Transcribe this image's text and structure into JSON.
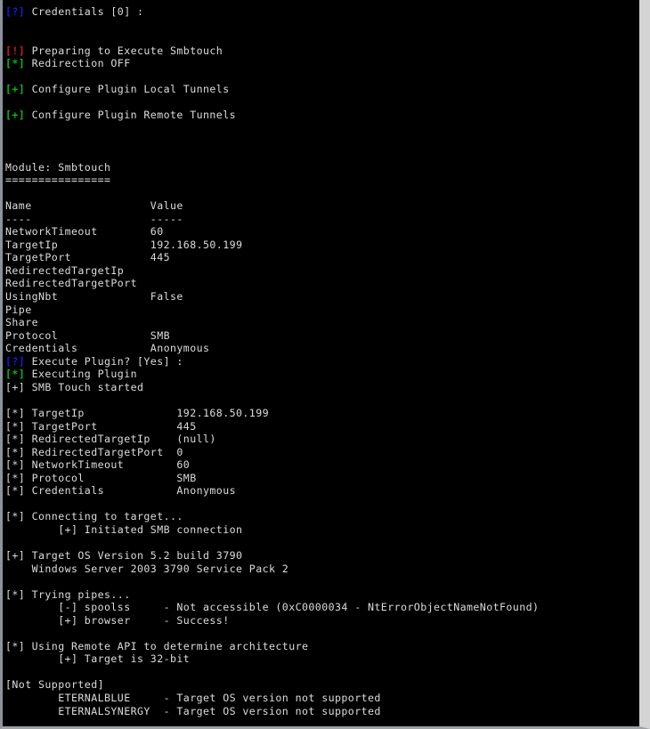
{
  "terminal": {
    "title": "fuzzbunch-smbtouch-console",
    "colors": {
      "background": "#000000",
      "foreground": "#d8d8d8",
      "prompt_blue": "#1a1ad6",
      "warn_red": "#c21f1f",
      "ok_green": "#10b410",
      "window_border": "#d4d4d4"
    },
    "lines": [
      {
        "tag": "[?]",
        "tag_color": "blue",
        "text": " Credentials [0] :"
      },
      {
        "tag": "",
        "tag_color": "none",
        "text": ""
      },
      {
        "tag": "",
        "tag_color": "none",
        "text": ""
      },
      {
        "tag": "[!]",
        "tag_color": "red",
        "text": " Preparing to Execute Smbtouch"
      },
      {
        "tag": "[*]",
        "tag_color": "green",
        "text": " Redirection OFF"
      },
      {
        "tag": "",
        "tag_color": "none",
        "text": ""
      },
      {
        "tag": "[+]",
        "tag_color": "green",
        "text": " Configure Plugin Local Tunnels"
      },
      {
        "tag": "",
        "tag_color": "none",
        "text": ""
      },
      {
        "tag": "[+]",
        "tag_color": "green",
        "text": " Configure Plugin Remote Tunnels"
      },
      {
        "tag": "",
        "tag_color": "none",
        "text": ""
      },
      {
        "tag": "",
        "tag_color": "none",
        "text": ""
      },
      {
        "tag": "",
        "tag_color": "none",
        "text": ""
      },
      {
        "tag": "",
        "tag_color": "none",
        "text": "Module: Smbtouch"
      },
      {
        "tag": "",
        "tag_color": "none",
        "text": "================"
      },
      {
        "tag": "",
        "tag_color": "none",
        "text": ""
      },
      {
        "tag": "",
        "tag_color": "none",
        "text": "Name                  Value"
      },
      {
        "tag": "",
        "tag_color": "none",
        "text": "----                  -----"
      },
      {
        "tag": "",
        "tag_color": "none",
        "text": "NetworkTimeout        60"
      },
      {
        "tag": "",
        "tag_color": "none",
        "text": "TargetIp              192.168.50.199"
      },
      {
        "tag": "",
        "tag_color": "none",
        "text": "TargetPort            445"
      },
      {
        "tag": "",
        "tag_color": "none",
        "text": "RedirectedTargetIp"
      },
      {
        "tag": "",
        "tag_color": "none",
        "text": "RedirectedTargetPort"
      },
      {
        "tag": "",
        "tag_color": "none",
        "text": "UsingNbt              False"
      },
      {
        "tag": "",
        "tag_color": "none",
        "text": "Pipe"
      },
      {
        "tag": "",
        "tag_color": "none",
        "text": "Share"
      },
      {
        "tag": "",
        "tag_color": "none",
        "text": "Protocol              SMB"
      },
      {
        "tag": "",
        "tag_color": "none",
        "text": "Credentials           Anonymous"
      },
      {
        "tag": "[?]",
        "tag_color": "blue",
        "text": " Execute Plugin? [Yes] :"
      },
      {
        "tag": "[*]",
        "tag_color": "green",
        "text": " Executing Plugin"
      },
      {
        "tag": "[+]",
        "tag_color": "white",
        "text": " SMB Touch started"
      },
      {
        "tag": "",
        "tag_color": "none",
        "text": ""
      },
      {
        "tag": "[*]",
        "tag_color": "white",
        "text": " TargetIp              192.168.50.199"
      },
      {
        "tag": "[*]",
        "tag_color": "white",
        "text": " TargetPort            445"
      },
      {
        "tag": "[*]",
        "tag_color": "white",
        "text": " RedirectedTargetIp    (null)"
      },
      {
        "tag": "[*]",
        "tag_color": "white",
        "text": " RedirectedTargetPort  0"
      },
      {
        "tag": "[*]",
        "tag_color": "white",
        "text": " NetworkTimeout        60"
      },
      {
        "tag": "[*]",
        "tag_color": "white",
        "text": " Protocol              SMB"
      },
      {
        "tag": "[*]",
        "tag_color": "white",
        "text": " Credentials           Anonymous"
      },
      {
        "tag": "",
        "tag_color": "none",
        "text": ""
      },
      {
        "tag": "[*]",
        "tag_color": "white",
        "text": " Connecting to target..."
      },
      {
        "tag": "",
        "tag_color": "none",
        "text": "        [+] Initiated SMB connection"
      },
      {
        "tag": "",
        "tag_color": "none",
        "text": ""
      },
      {
        "tag": "[+]",
        "tag_color": "white",
        "text": " Target OS Version 5.2 build 3790"
      },
      {
        "tag": "",
        "tag_color": "none",
        "text": "    Windows Server 2003 3790 Service Pack 2"
      },
      {
        "tag": "",
        "tag_color": "none",
        "text": ""
      },
      {
        "tag": "[*]",
        "tag_color": "white",
        "text": " Trying pipes..."
      },
      {
        "tag": "",
        "tag_color": "none",
        "text": "        [-] spoolss     - Not accessible (0xC0000034 - NtErrorObjectNameNotFound)"
      },
      {
        "tag": "",
        "tag_color": "none",
        "text": "        [+] browser     - Success!"
      },
      {
        "tag": "",
        "tag_color": "none",
        "text": ""
      },
      {
        "tag": "[*]",
        "tag_color": "white",
        "text": " Using Remote API to determine architecture"
      },
      {
        "tag": "",
        "tag_color": "none",
        "text": "        [+] Target is 32-bit"
      },
      {
        "tag": "",
        "tag_color": "none",
        "text": ""
      },
      {
        "tag": "",
        "tag_color": "none",
        "text": "[Not Supported]"
      },
      {
        "tag": "",
        "tag_color": "none",
        "text": "        ETERNALBLUE     - Target OS version not supported"
      },
      {
        "tag": "",
        "tag_color": "none",
        "text": "        ETERNALSYNERGY  - Target OS version not supported"
      }
    ]
  }
}
